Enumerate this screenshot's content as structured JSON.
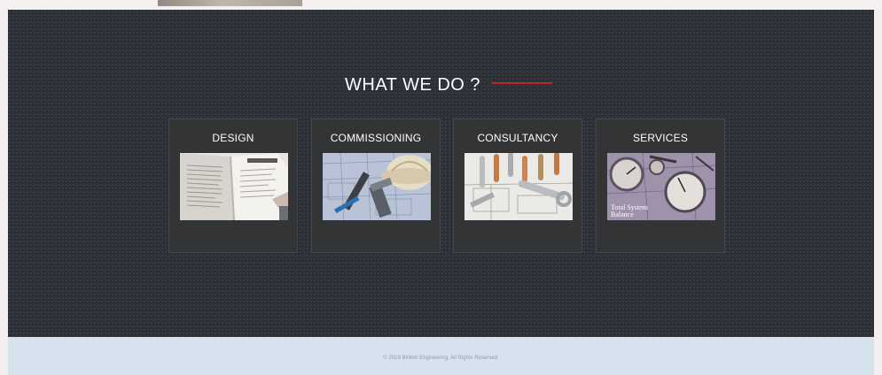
{
  "section": {
    "title": "WHAT WE DO ?"
  },
  "cards": [
    {
      "title": "DESIGN",
      "image": "design-document-image"
    },
    {
      "title": "COMMISSIONING",
      "image": "blueprint-hardhat-tools-image"
    },
    {
      "title": "CONSULTANCY",
      "image": "pipes-wrench-blueprint-image"
    },
    {
      "title": "SERVICES",
      "image": "gauges-blueprint-image",
      "image_caption": "Total System Balance"
    }
  ],
  "footer": {
    "copyright": "© 2019 Birikim Engineering. All Rights Reserved."
  },
  "colors": {
    "section_bg": "#2b2f36",
    "card_bg": "#323436",
    "accent_line": "#c0262b",
    "footer_bg": "#d6e3ef"
  }
}
